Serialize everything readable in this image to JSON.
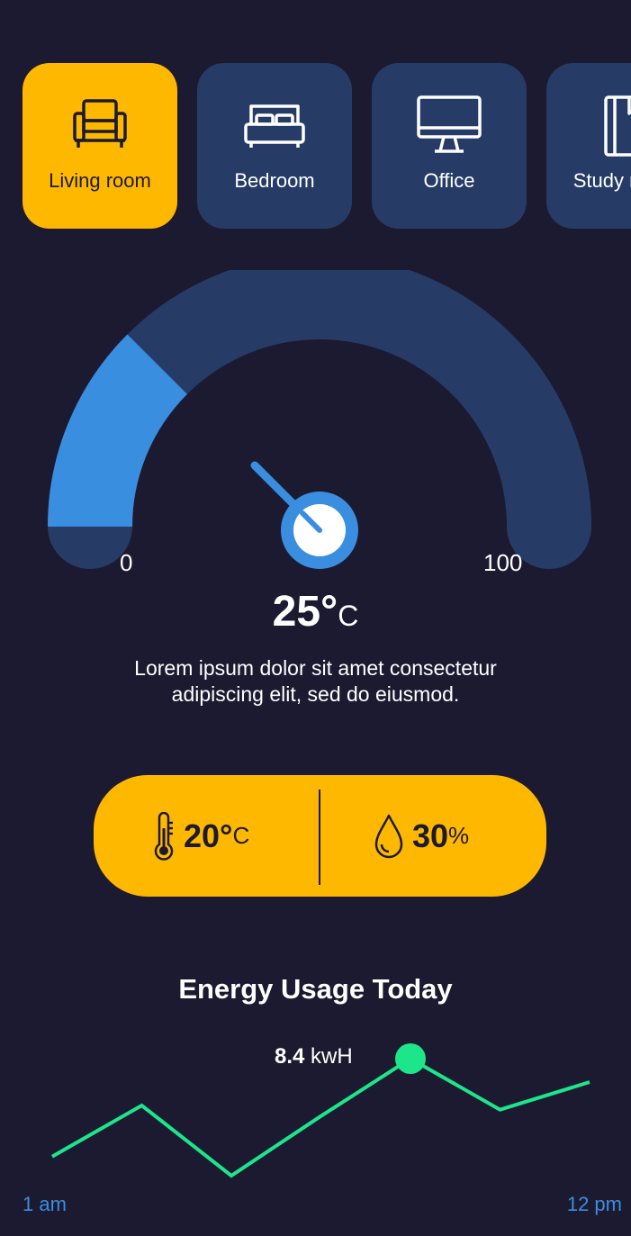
{
  "rooms": [
    {
      "label": "Living room",
      "icon": "sofa-icon",
      "active": true
    },
    {
      "label": "Bedroom",
      "icon": "bed-icon",
      "active": false
    },
    {
      "label": "Office",
      "icon": "monitor-icon",
      "active": false
    },
    {
      "label": "Study room",
      "icon": "book-icon",
      "active": false
    }
  ],
  "gauge": {
    "min": "0",
    "max": "100",
    "value": 25,
    "temp_value": "25°",
    "temp_unit": "C",
    "description": "Lorem ipsum dolor sit amet consectetur adipiscing elit, sed do eiusmod."
  },
  "stats": {
    "temperature_value": "20°",
    "temperature_unit": "C",
    "humidity_value": "30",
    "humidity_unit": "%"
  },
  "energy": {
    "title": "Energy Usage Today",
    "peak_value": "8.4",
    "peak_unit": "kwH",
    "x_start": "1 am",
    "x_end": "12 pm"
  },
  "colors": {
    "background": "#1c1a31",
    "card": "#263c66",
    "accent": "#ffb800",
    "gauge_fill": "#3a8ee0",
    "line": "#1de58a"
  },
  "chart_data": {
    "type": "line",
    "title": "Energy Usage Today",
    "x": [
      "1 am",
      "",
      "",
      "",
      "",
      "",
      "12 pm"
    ],
    "series": [
      {
        "values": [
          3.8,
          6.2,
          2.9,
          5.7,
          8.4,
          6.0,
          7.3
        ]
      }
    ],
    "annotations": [
      {
        "x_index": 4,
        "label": "8.4 kwH"
      }
    ]
  }
}
